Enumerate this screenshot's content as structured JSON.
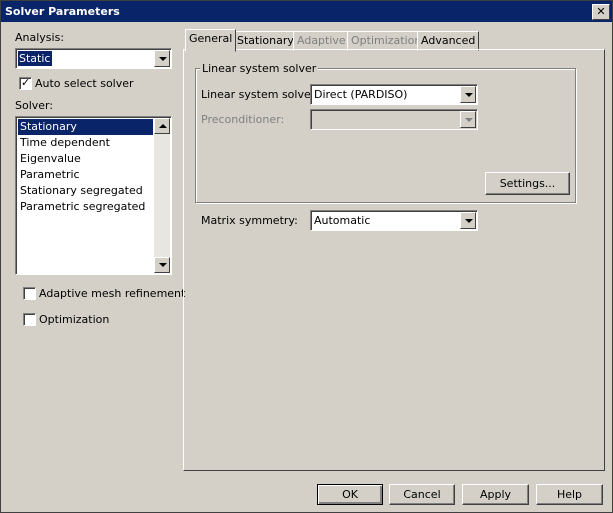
{
  "window": {
    "title": "Solver Parameters",
    "close_glyph": "✕"
  },
  "left": {
    "analysis_label": "Analysis:",
    "analysis_value": "Static",
    "auto_select_label": "Auto select solver",
    "auto_select_checked": true,
    "solver_label": "Solver:",
    "solvers": [
      "Stationary",
      "Time dependent",
      "Eigenvalue",
      "Parametric",
      "Stationary segregated",
      "Parametric segregated"
    ],
    "solver_selected": "Stationary",
    "adaptive_label": "Adaptive mesh refinement",
    "adaptive_checked": false,
    "optimization_label": "Optimization",
    "optimization_checked": false
  },
  "tabs": [
    {
      "label": "General",
      "active": true,
      "enabled": true
    },
    {
      "label": "Stationary",
      "active": false,
      "enabled": true
    },
    {
      "label": "Adaptive",
      "active": false,
      "enabled": false
    },
    {
      "label": "Optimization",
      "active": false,
      "enabled": false
    },
    {
      "label": "Advanced",
      "active": false,
      "enabled": true
    }
  ],
  "general": {
    "group_title": "Linear system solver",
    "linear_solver_label": "Linear system solver:",
    "linear_solver_value": "Direct (PARDISO)",
    "preconditioner_label": "Preconditioner:",
    "preconditioner_value": "",
    "settings_button": "Settings...",
    "matrix_symmetry_label": "Matrix symmetry:",
    "matrix_symmetry_value": "Automatic"
  },
  "buttons": {
    "ok": "OK",
    "cancel": "Cancel",
    "apply": "Apply",
    "help": "Help"
  },
  "icons": {
    "checkmark": "check-icon",
    "dropdown": "chevron-down-icon",
    "scroll_up": "arrow-up-icon",
    "scroll_down": "arrow-down-icon"
  },
  "colors": {
    "titlebar": "#0a246a",
    "selection": "#0a246a",
    "face": "#d4d0c8"
  }
}
